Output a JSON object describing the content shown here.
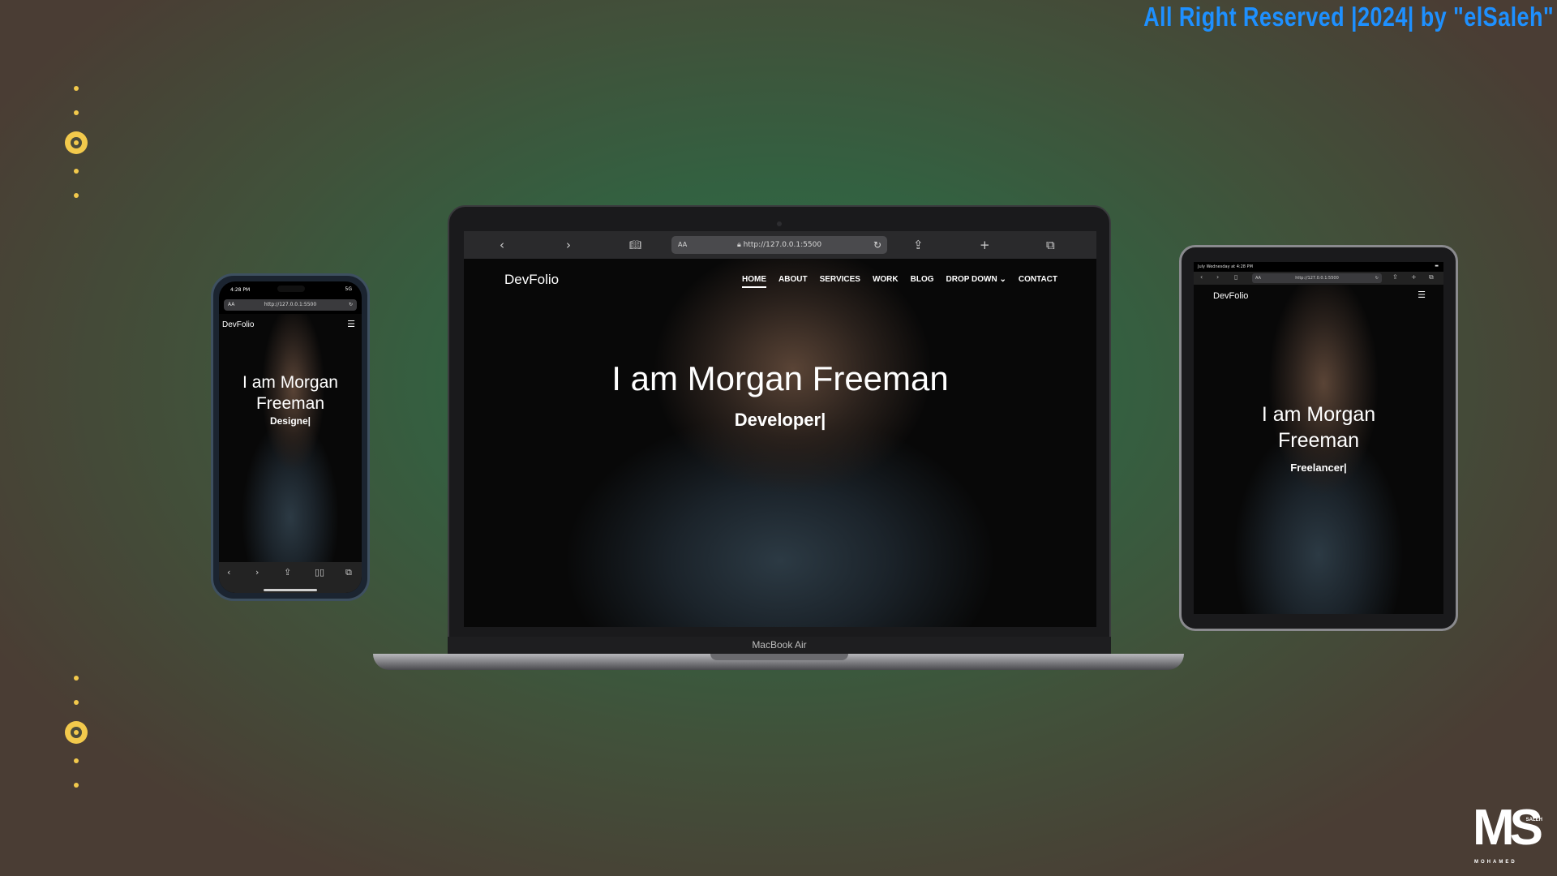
{
  "copyright": "All Right Reserved |2024| by \"elSaleh\"",
  "colors": {
    "accent": "#1e90ff",
    "dots": "#f2c94c"
  },
  "site": {
    "brand": "DevFolio",
    "name": "I am Morgan Freeman",
    "nav": [
      "HOME",
      "ABOUT",
      "SERVICES",
      "WORK",
      "BLOG",
      "DROP DOWN",
      "CONTACT"
    ],
    "dropdown_icon": "chevron-down-icon",
    "url": "http://127.0.0.1:5500"
  },
  "laptop": {
    "label": "MacBook Air",
    "aa": "AA",
    "role": "Developer|",
    "icons": [
      "chevron-left-icon",
      "chevron-right-icon",
      "book-icon",
      "lock-icon",
      "reload-icon",
      "share-icon",
      "plus-icon",
      "tabs-icon"
    ]
  },
  "phone": {
    "time": "4:28 PM",
    "signal": "5G",
    "aa": "AA",
    "url": "http://127.0.0.1:5500",
    "title": "I am Morgan Freeman",
    "role": "Designe|",
    "icons": [
      "chevron-left-icon",
      "chevron-right-icon",
      "share-icon",
      "book-icon",
      "tabs-icon",
      "menu-icon"
    ]
  },
  "tablet": {
    "status_left": "July Wednesday at 4:28 PM",
    "url": "http://127.0.0.1:5500",
    "aa": "AA",
    "title": "I am Morgan Freeman",
    "role": "Freelancer|",
    "icons": [
      "chevron-left-icon",
      "chevron-right-icon",
      "book-icon",
      "reload-icon",
      "share-icon",
      "plus-icon",
      "tabs-icon",
      "menu-icon"
    ]
  },
  "logo": {
    "initials": "MS",
    "top": "SALEH",
    "bottom": "MOHAMED"
  }
}
